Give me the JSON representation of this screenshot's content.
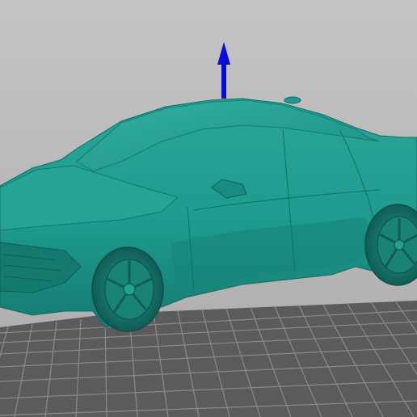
{
  "viewport": {
    "background_top": "#c4c4c4",
    "background_bottom": "#a9a9a9"
  },
  "build_plate": {
    "fill": "#5b5b5b",
    "grid_line": "#8a8a8a"
  },
  "model": {
    "color": "#1e9a8e",
    "shade_color": "#14776d",
    "highlight_color": "#36b3a6"
  },
  "gizmo": {
    "axis": "z",
    "icon": "z-axis-arrow-icon",
    "color": "#0b0bd6"
  }
}
